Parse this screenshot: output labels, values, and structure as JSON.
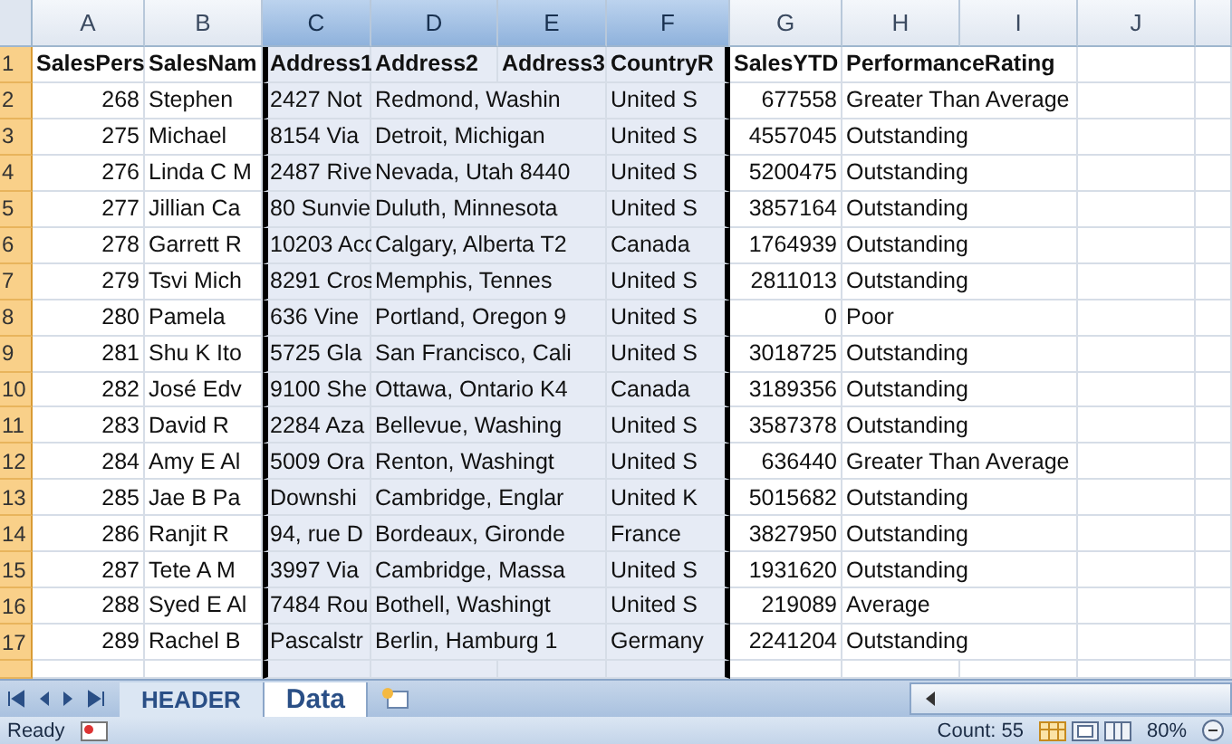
{
  "columns": [
    {
      "letter": "A",
      "selected": false
    },
    {
      "letter": "B",
      "selected": false
    },
    {
      "letter": "C",
      "selected": true
    },
    {
      "letter": "D",
      "selected": true
    },
    {
      "letter": "E",
      "selected": true
    },
    {
      "letter": "F",
      "selected": true
    },
    {
      "letter": "G",
      "selected": false
    },
    {
      "letter": "H",
      "selected": false
    },
    {
      "letter": "I",
      "selected": false
    },
    {
      "letter": "J",
      "selected": false
    }
  ],
  "rows": [
    {
      "number": "1",
      "kind": "header",
      "a": "SalesPers",
      "b": "SalesNam",
      "c": "Address1",
      "d": "Address2",
      "e": "Address3",
      "f": "CountryR",
      "g": "SalesYTD",
      "h": "PerformanceRating"
    },
    {
      "number": "2",
      "kind": "data",
      "a": "268",
      "b": "Stephen",
      "c": "2427 Not",
      "d": "Redmond, Washin",
      "f": "United S",
      "g": "677558",
      "h": "Greater Than Average"
    },
    {
      "number": "3",
      "kind": "data",
      "a": "275",
      "b": "Michael",
      "c": "8154 Via",
      "d": "Detroit, Michigan",
      "f": "United S",
      "g": "4557045",
      "h": "Outstanding"
    },
    {
      "number": "4",
      "kind": "data",
      "a": "276",
      "b": "Linda C M",
      "c": "2487 Rive",
      "d": "Nevada, Utah 8440",
      "f": "United S",
      "g": "5200475",
      "h": "Outstanding"
    },
    {
      "number": "5",
      "kind": "data",
      "a": "277",
      "b": "Jillian Ca",
      "c": "80 Sunvie",
      "d": "Duluth, Minnesota",
      "f": "United S",
      "g": "3857164",
      "h": "Outstanding"
    },
    {
      "number": "6",
      "kind": "data",
      "a": "278",
      "b": "Garrett R",
      "c": "10203 Acc",
      "d": "Calgary, Alberta T2",
      "f": "Canada",
      "g": "1764939",
      "h": "Outstanding"
    },
    {
      "number": "7",
      "kind": "data",
      "a": "279",
      "b": "Tsvi Mich",
      "c": "8291 Cros",
      "d": "Memphis, Tennes",
      "f": "United S",
      "g": "2811013",
      "h": "Outstanding"
    },
    {
      "number": "8",
      "kind": "data",
      "a": "280",
      "b": "Pamela",
      "c": "636 Vine",
      "d": "Portland, Oregon 9",
      "f": "United S",
      "g": "0",
      "h": "Poor"
    },
    {
      "number": "9",
      "kind": "data",
      "a": "281",
      "b": "Shu K Ito",
      "c": "5725 Gla",
      "d": "San Francisco, Cali",
      "f": "United S",
      "g": "3018725",
      "h": "Outstanding"
    },
    {
      "number": "10",
      "kind": "data",
      "a": "282",
      "b": "José Edv",
      "c": "9100 She",
      "d": "Ottawa, Ontario K4",
      "f": "Canada",
      "g": "3189356",
      "h": "Outstanding"
    },
    {
      "number": "11",
      "kind": "data",
      "a": "283",
      "b": "David R",
      "c": "2284 Aza",
      "d": "Bellevue, Washing",
      "f": "United S",
      "g": "3587378",
      "h": "Outstanding"
    },
    {
      "number": "12",
      "kind": "data",
      "a": "284",
      "b": "Amy E Al",
      "c": "5009 Ora",
      "d": "Renton, Washingt",
      "f": "United S",
      "g": "636440",
      "h": "Greater Than Average"
    },
    {
      "number": "13",
      "kind": "data",
      "a": "285",
      "b": "Jae B Pa",
      "c": "Downshi",
      "d": "Cambridge, Englar",
      "f": "United K",
      "g": "5015682",
      "h": "Outstanding"
    },
    {
      "number": "14",
      "kind": "data",
      "a": "286",
      "b": "Ranjit R",
      "c": "94, rue D",
      "d": "Bordeaux, Gironde",
      "f": "France",
      "g": "3827950",
      "h": "Outstanding"
    },
    {
      "number": "15",
      "kind": "data",
      "a": "287",
      "b": "Tete A M",
      "c": "3997 Via",
      "d": "Cambridge, Massa",
      "f": "United S",
      "g": "1931620",
      "h": "Outstanding"
    },
    {
      "number": "16",
      "kind": "data",
      "a": "288",
      "b": "Syed E Al",
      "c": "7484 Rou",
      "d": "Bothell, Washingt",
      "f": "United S",
      "g": "219089",
      "h": "Average"
    },
    {
      "number": "17",
      "kind": "data",
      "a": "289",
      "b": "Rachel B",
      "c": "Pascalstr",
      "d": "Berlin, Hamburg 1",
      "f": "Germany",
      "g": "2241204",
      "h": "Outstanding"
    }
  ],
  "sheet_tabs": [
    {
      "label": "HEADER",
      "selected": false
    },
    {
      "label": "Data",
      "selected": true
    }
  ],
  "status_bar": {
    "mode": "Ready",
    "count": "Count: 55",
    "zoom": "80%"
  }
}
